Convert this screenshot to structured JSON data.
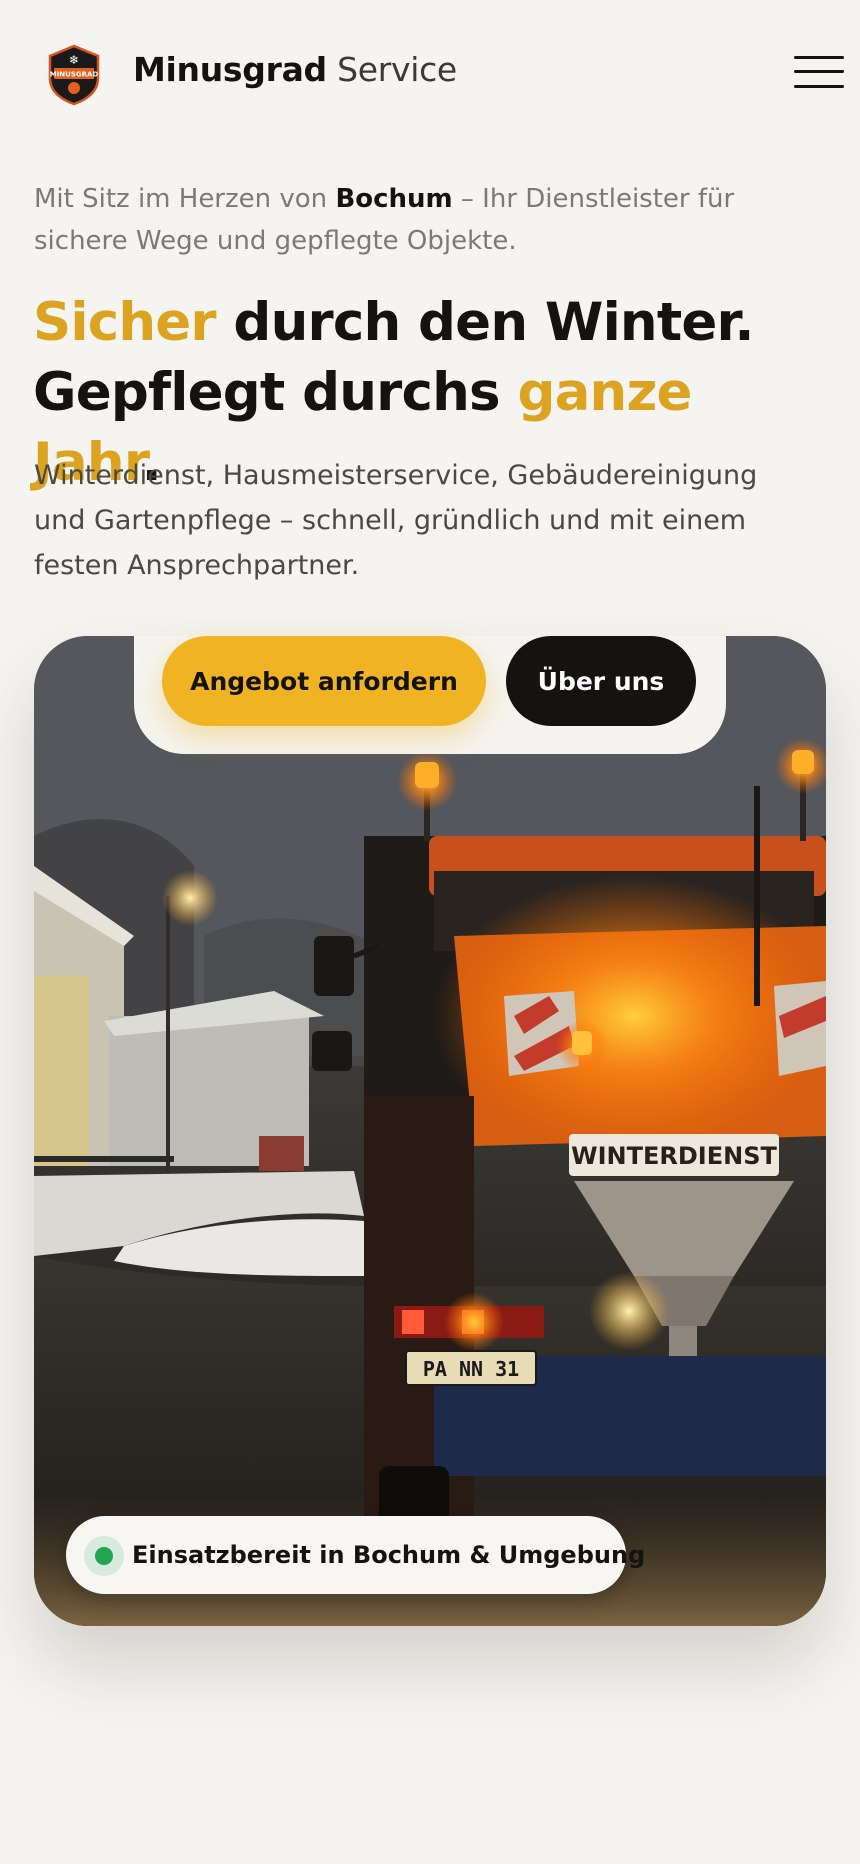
{
  "header": {
    "brand_bold": "Minusgrad",
    "brand_light": "Service",
    "logo_icon": "minusgrad-shield-logo",
    "logo_text": "MINUSGRAD",
    "menu_icon": "hamburger-menu-icon"
  },
  "intro": {
    "before": "Mit Sitz im Herzen von ",
    "city": "Bochum",
    "after": " – Ihr Dienstleister für sichere Wege und gepflegte Objekte."
  },
  "headline": {
    "w1": "Sicher",
    "w2": " durch den Winter.",
    "w3": "Gepflegt durchs ",
    "w4": "ganze Jahr",
    "w5": "."
  },
  "lead": "Winterdienst, Hausmeisterservice, Gebäudereinigung und Gartenpflege – schnell, gründlich und mit einem festen Ansprechpartner.",
  "cta": {
    "primary": "Angebot anfordern",
    "secondary": "Über uns"
  },
  "hero": {
    "image_subject": "winter-service-truck-photo",
    "truck_sign": "WINTERDIENST",
    "plate": "PA NN 31",
    "status": "Einsatzbereit in Bochum & Umgebung"
  },
  "colors": {
    "accent": "#f0b323",
    "accent_text": "#dba31f",
    "dark": "#141310",
    "background": "#f5f4f0",
    "status_green": "#22a552"
  }
}
